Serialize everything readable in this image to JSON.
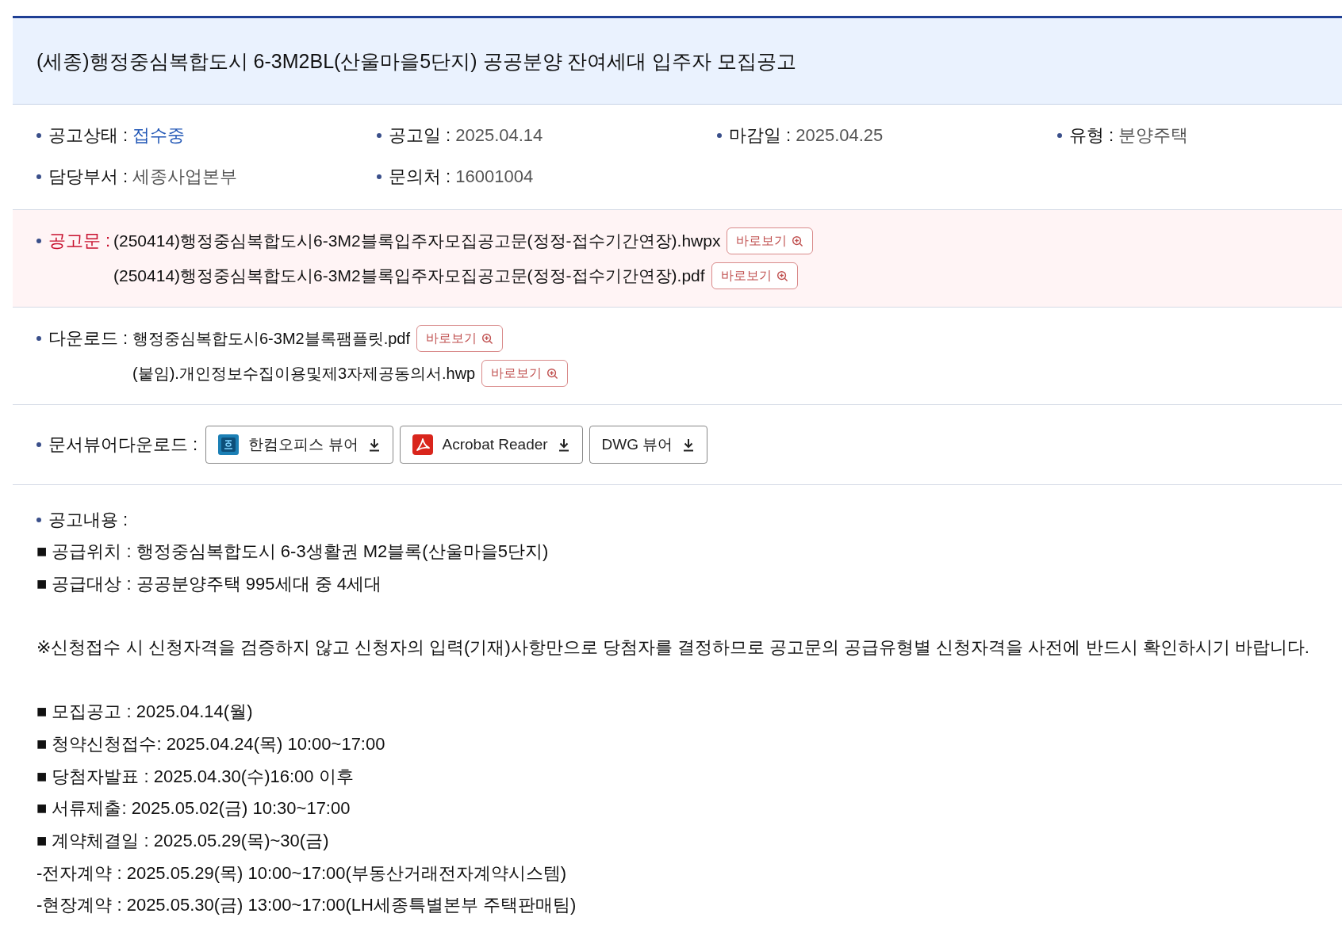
{
  "title": "(세종)행정중심복합도시 6-3M2BL(산울마을5단지) 공공분양 잔여세대 입주자 모집공고",
  "info": [
    {
      "label": "공고상태 :",
      "value": "접수중",
      "highlighted": true
    },
    {
      "label": "공고일 :",
      "value": "2025.04.14",
      "highlighted": false
    },
    {
      "label": "마감일 :",
      "value": "2025.04.25",
      "highlighted": false
    },
    {
      "label": "유형 :",
      "value": "분양주택",
      "highlighted": false
    },
    {
      "label": "담당부서 :",
      "value": "세종사업본부",
      "highlighted": false
    },
    {
      "label": "문의처 :",
      "value": "16001004",
      "highlighted": false
    }
  ],
  "notice": {
    "label": "공고문 :",
    "files": [
      {
        "name": "(250414)행정중심복합도시6-3M2블록입주자모집공고문(정정-접수기간연장).hwpx",
        "button": "바로보기"
      },
      {
        "name": "(250414)행정중심복합도시6-3M2블록입주자모집공고문(정정-접수기간연장).pdf",
        "button": "바로보기"
      }
    ]
  },
  "downloads": {
    "label": "다운로드 :",
    "files": [
      {
        "name": "행정중심복합도시6-3M2블록팸플릿.pdf",
        "button": "바로보기"
      },
      {
        "name": "(붙임).개인정보수집이용및제3자제공동의서.hwp",
        "button": "바로보기"
      }
    ]
  },
  "viewers": {
    "label": "문서뷰어다운로드 :",
    "buttons": [
      {
        "label": "한컴오피스 뷰어",
        "kind": "hancom"
      },
      {
        "label": "Acrobat Reader",
        "kind": "acrobat"
      },
      {
        "label": "DWG 뷰어",
        "kind": "plain"
      }
    ]
  },
  "content": {
    "label": "공고내용 :",
    "groups": [
      [
        "■ 공급위치 : 행정중심복합도시 6-3생활권 M2블록(산울마을5단지)",
        "■ 공급대상 : 공공분양주택 995세대 중 4세대"
      ],
      [
        "※신청접수 시 신청자격을 검증하지 않고 신청자의 입력(기재)사항만으로 당첨자를 결정하므로 공고문의 공급유형별 신청자격을 사전에 반드시 확인하시기 바랍니다."
      ],
      [
        "■ 모집공고 : 2025.04.14(월)",
        "■ 청약신청접수: 2025.04.24(목) 10:00~17:00",
        "■ 당첨자발표 : 2025.04.30(수)16:00 이후",
        "■ 서류제출: 2025.05.02(금) 10:30~17:00",
        "■ 계약체결일 : 2025.05.29(목)~30(금)",
        "-전자계약 : 2025.05.29(목) 10:00~17:00(부동산거래전자계약시스템)",
        "-현장계약 : 2025.05.30(금) 13:00~17:00(LH세종특별본부 주택판매팀)"
      ]
    ]
  }
}
